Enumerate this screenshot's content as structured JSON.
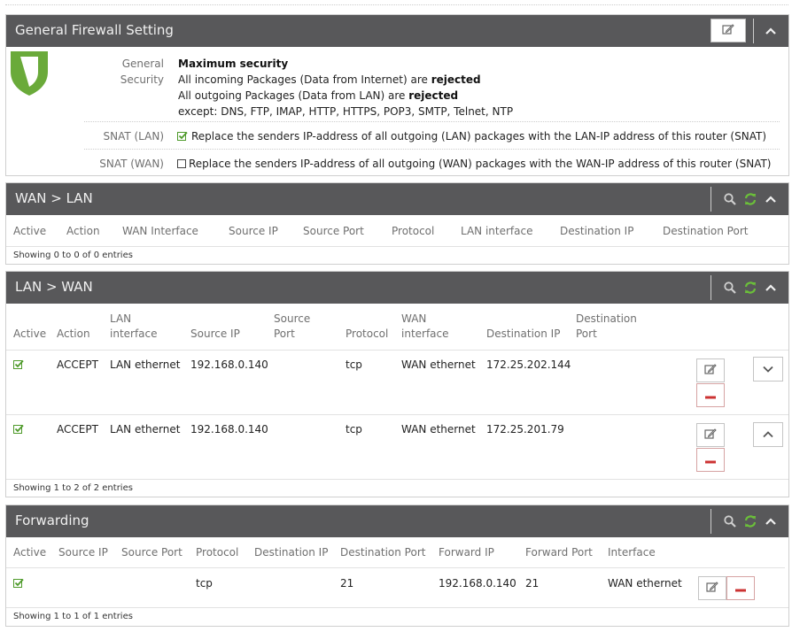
{
  "colors": {
    "header_bg": "#58585a",
    "shield": "#6aaa3a",
    "check": "#4e9a2a",
    "refresh": "#4e9a2a",
    "remove": "#cc3333"
  },
  "general": {
    "title": "General Firewall Setting",
    "security_label_1": "General",
    "security_label_2": "Security",
    "security_title": "Maximum security",
    "incoming_prefix": "All incoming Packages (Data from Internet) are",
    "incoming_status": "rejected",
    "outgoing_prefix": "All outgoing Packages (Data from LAN) are",
    "outgoing_status": "rejected",
    "except_text": "except: DNS, FTP, IMAP, HTTP, HTTPS, POP3, SMTP, Telnet, NTP",
    "snat_lan_label": "SNAT (LAN)",
    "snat_lan_checked": true,
    "snat_lan_text": "Replace the senders IP-address of all outgoing (LAN) packages with the LAN-IP address of this router (SNAT)",
    "snat_wan_label": "SNAT (WAN)",
    "snat_wan_checked": false,
    "snat_wan_text": "Replace the senders IP-address of all outgoing (WAN) packages with the WAN-IP address of this router (SNAT)"
  },
  "wan_lan": {
    "title": "WAN > LAN",
    "columns": [
      "Active",
      "Action",
      "WAN Interface",
      "Source IP",
      "Source Port",
      "Protocol",
      "LAN interface",
      "Destination IP",
      "Destination Port"
    ],
    "footer": "Showing 0 to 0 of 0 entries"
  },
  "lan_wan": {
    "title": "LAN > WAN",
    "columns": [
      {
        "line1": "",
        "line2": "Active"
      },
      {
        "line1": "",
        "line2": "Action"
      },
      {
        "line1": "LAN",
        "line2": "interface"
      },
      {
        "line1": "",
        "line2": "Source IP"
      },
      {
        "line1": "Source",
        "line2": "Port"
      },
      {
        "line1": "",
        "line2": "Protocol"
      },
      {
        "line1": "WAN",
        "line2": "interface"
      },
      {
        "line1": "",
        "line2": "Destination IP"
      },
      {
        "line1": "Destination",
        "line2": "Port"
      }
    ],
    "rows": [
      {
        "active": true,
        "action": "ACCEPT",
        "lan_interface": "LAN ethernet",
        "source_ip": "192.168.0.140",
        "source_port": "",
        "protocol": "tcp",
        "wan_interface": "WAN ethernet",
        "destination_ip": "172.25.202.144",
        "destination_port": "",
        "move": "down"
      },
      {
        "active": true,
        "action": "ACCEPT",
        "lan_interface": "LAN ethernet",
        "source_ip": "192.168.0.140",
        "source_port": "",
        "protocol": "tcp",
        "wan_interface": "WAN ethernet",
        "destination_ip": "172.25.201.79",
        "destination_port": "",
        "move": "up"
      }
    ],
    "footer": "Showing 1 to 2 of 2 entries"
  },
  "forwarding": {
    "title": "Forwarding",
    "columns": [
      "Active",
      "Source IP",
      "Source Port",
      "Protocol",
      "Destination IP",
      "Destination Port",
      "Forward IP",
      "Forward Port",
      "Interface"
    ],
    "rows": [
      {
        "active": true,
        "source_ip": "",
        "source_port": "",
        "protocol": "tcp",
        "destination_ip": "",
        "destination_port": "21",
        "forward_ip": "192.168.0.140",
        "forward_port": "21",
        "interface": "WAN ethernet"
      }
    ],
    "footer": "Showing 1 to 1 of 1 entries"
  },
  "icons": [
    "shield-icon",
    "edit-icon",
    "collapse-icon",
    "search-icon",
    "refresh-icon",
    "checkbox-checked-icon",
    "checkbox-empty-icon",
    "remove-icon",
    "move-down-icon",
    "move-up-icon"
  ]
}
